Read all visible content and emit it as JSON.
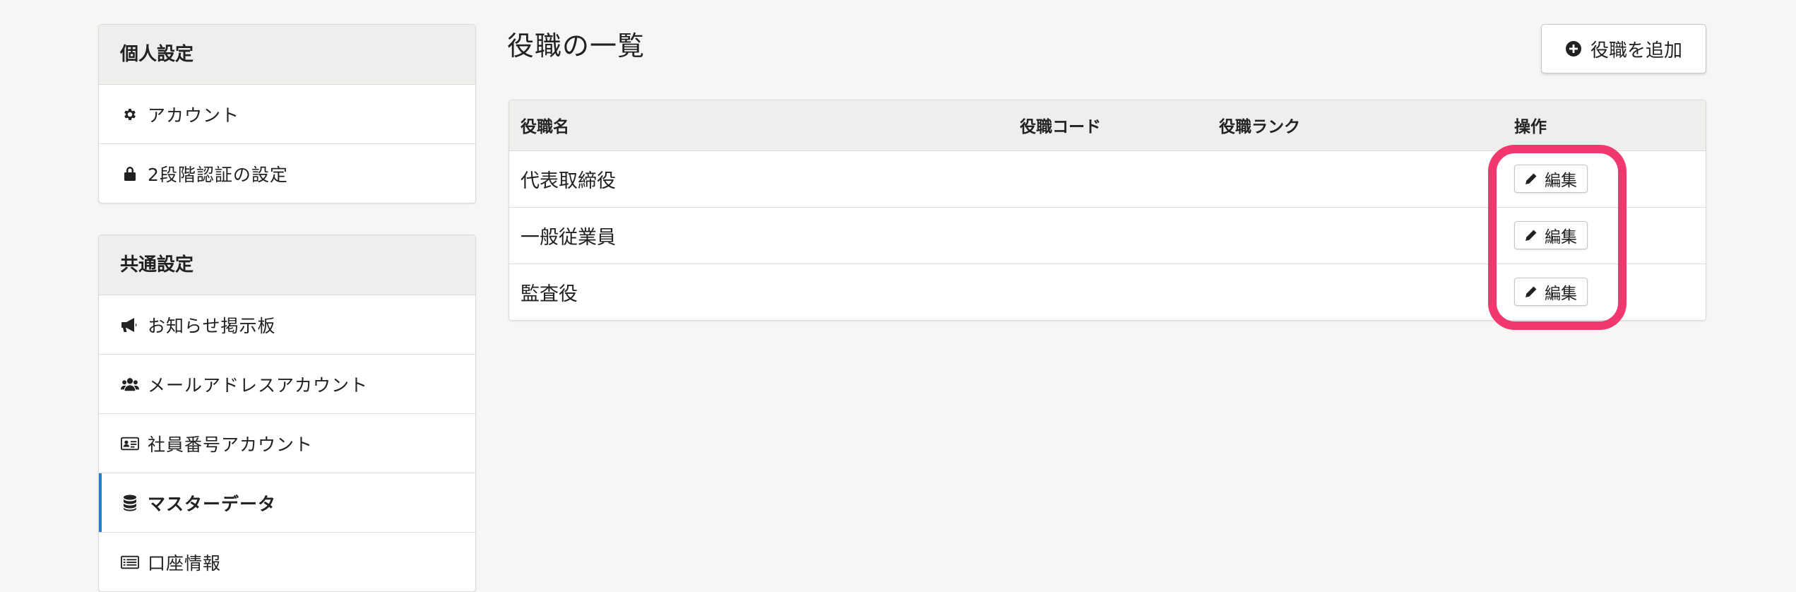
{
  "sidebar": {
    "personal": {
      "header": "個人設定",
      "items": [
        {
          "label": "アカウント",
          "icon": "gear-icon"
        },
        {
          "label": "2段階認証の設定",
          "icon": "lock-icon"
        }
      ]
    },
    "common": {
      "header": "共通設定",
      "items": [
        {
          "label": "お知らせ掲示板",
          "icon": "megaphone-icon"
        },
        {
          "label": "メールアドレスアカウント",
          "icon": "users-icon"
        },
        {
          "label": "社員番号アカウント",
          "icon": "id-card-icon"
        },
        {
          "label": "マスターデータ",
          "icon": "database-icon",
          "active": true
        },
        {
          "label": "口座情報",
          "icon": "list-icon"
        }
      ]
    }
  },
  "main": {
    "title": "役職の一覧",
    "add_button": "役職を追加",
    "table": {
      "columns": [
        "役職名",
        "役職コード",
        "役職ランク",
        "操作"
      ],
      "rows": [
        {
          "name": "代表取締役",
          "code": "",
          "rank": "",
          "action": "編集"
        },
        {
          "name": "一般従業員",
          "code": "",
          "rank": "",
          "action": "編集"
        },
        {
          "name": "監査役",
          "code": "",
          "rank": "",
          "action": "編集"
        }
      ]
    }
  },
  "colors": {
    "accent": "#1e7fd4",
    "highlight": "#f0386f"
  }
}
